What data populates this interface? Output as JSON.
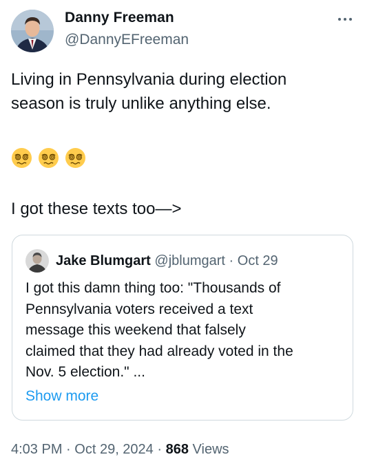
{
  "author": {
    "name": "Danny Freeman",
    "handle": "@DannyEFreeman",
    "avatar_icon": "profile-photo-avatar"
  },
  "menu_icon": "more-horizontal-icon",
  "tweet": {
    "line1": "Living in Pennsylvania during election",
    "line2": "season is truly unlike anything else.",
    "emojis": [
      "face-with-spiral-eyes-emoji",
      "face-with-spiral-eyes-emoji",
      "face-with-spiral-eyes-emoji"
    ],
    "line3": "I got these texts too—>"
  },
  "quoted_tweet": {
    "author_name": "Jake Blumgart",
    "author_handle": "@jblumgart",
    "separator": "·",
    "date": "Oct 29",
    "text_lines": [
      "I got this damn thing too: \"Thousands of",
      "Pennsylvania voters received a text",
      "message this weekend that falsely",
      "claimed that they had already voted in the",
      "Nov. 5 election.\" ..."
    ],
    "show_more": "Show more"
  },
  "meta": {
    "time": "4:03 PM",
    "sep1": "·",
    "date": "Oct 29, 2024",
    "sep2": "·",
    "views_count": "868",
    "views_label": "Views"
  },
  "colors": {
    "text": "#0f1419",
    "secondary": "#536471",
    "link": "#1d9bf0",
    "border": "#cfd9de"
  }
}
